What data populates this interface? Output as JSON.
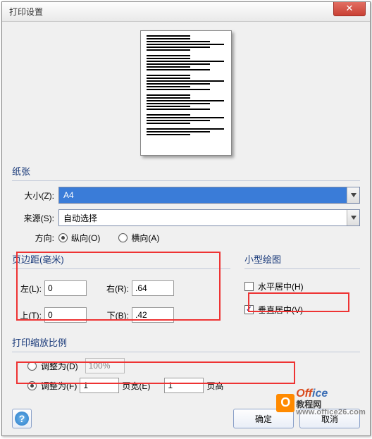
{
  "dialog": {
    "title": "打印设置",
    "close_symbol": "✕"
  },
  "paper": {
    "section_label": "纸张",
    "size_label": "大小(Z):",
    "size_value": "A4",
    "source_label": "来源(S):",
    "source_value": "自动选择"
  },
  "orientation": {
    "label": "方向:",
    "portrait": "纵向(O)",
    "landscape": "横向(A)",
    "selected": "portrait"
  },
  "margins": {
    "section_label": "页边距(毫米)",
    "left_label": "左(L):",
    "left_value": "0",
    "right_label": "右(R):",
    "right_value": ".64",
    "top_label": "上(T):",
    "top_value": "0",
    "bottom_label": "下(B):",
    "bottom_value": ".42"
  },
  "small_drawing": {
    "section_label": "小型绘图",
    "h_center": "水平居中(H)",
    "h_center_checked": false,
    "v_center": "垂直居中(V)",
    "v_center_checked": true
  },
  "scale": {
    "section_label": "打印缩放比例",
    "adjust_d": "调整为(D)",
    "adjust_d_value": "100%",
    "adjust_f": "调整为(F)",
    "pagewide_value": "1",
    "pagewide_label": "页宽(E)",
    "pagehigh_value": "1",
    "pagehigh_label": "页高",
    "selected": "f"
  },
  "buttons": {
    "help": "?",
    "ok": "确定",
    "cancel": "取消"
  },
  "watermark": {
    "off": "Off",
    "ice": "ice",
    "cn": "教程网",
    "url": "www.office26.com"
  }
}
